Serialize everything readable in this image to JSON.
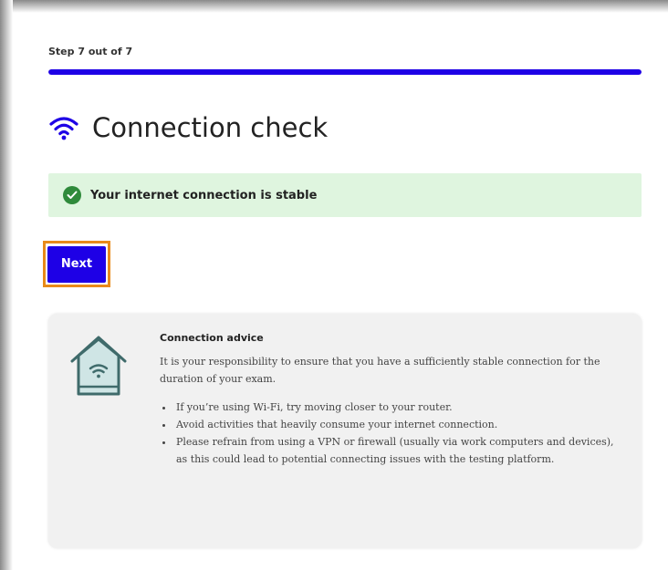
{
  "step": {
    "label": "Step 7 out of 7",
    "current": 7,
    "total": 7,
    "progress_fraction": 1.0
  },
  "header": {
    "title": "Connection check",
    "icon": "wifi-icon"
  },
  "status": {
    "message": "Your internet connection is stable",
    "icon": "check-circle-icon",
    "type": "success"
  },
  "actions": {
    "next_label": "Next"
  },
  "advice": {
    "icon": "house-wifi-icon",
    "title": "Connection advice",
    "text": "It is your responsibility to ensure that you have a sufficiently stable connection for the duration of your exam.",
    "items": [
      "If you’re using Wi-Fi, try moving closer to your router.",
      "Avoid activities that heavily consume your internet connection.",
      "Please refrain from using a VPN or firewall (usually via work computers and devices), as this could lead to potential connecting issues with the testing platform."
    ]
  },
  "colors": {
    "accent": "#1e00e6",
    "success_bg": "#dff5df",
    "success_icon": "#2f8a3b",
    "focus_ring": "#e88a1a",
    "advice_bg": "#f1f1f1",
    "house_color": "#3f6b6b",
    "house_fill": "#cfe5e5"
  }
}
